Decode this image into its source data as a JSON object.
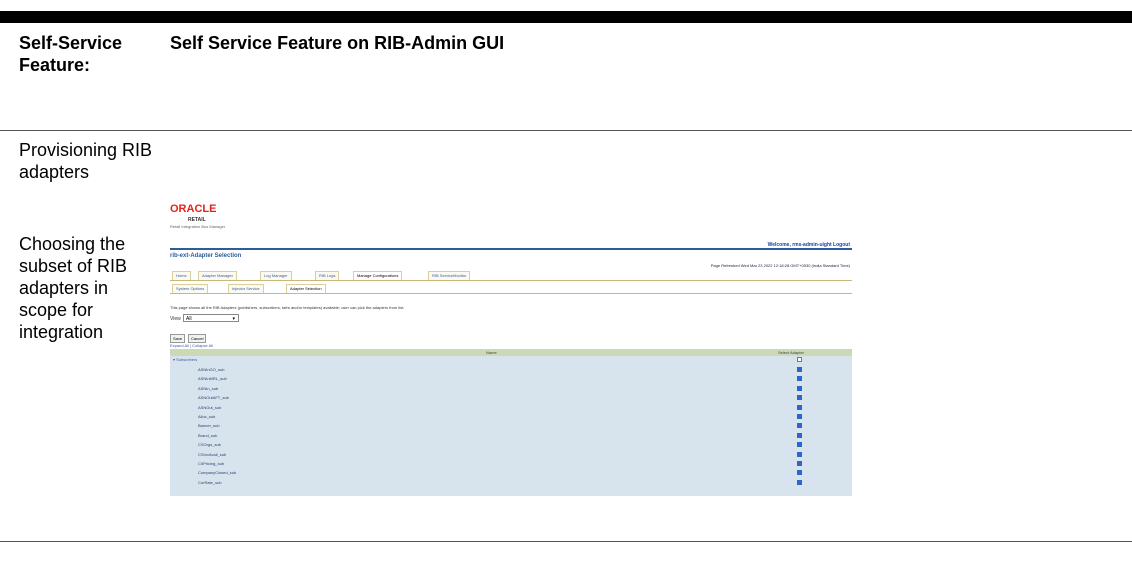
{
  "header": {
    "label": "Self-Service Feature:",
    "title": "Self Service Feature on RIB-Admin GUI"
  },
  "cells": [
    {
      "text": "Provisioning RIB adapters"
    },
    {
      "text": "Choosing the subset of RIB adapters in scope for integration"
    }
  ],
  "screenshot": {
    "logo": "ORACLE",
    "logo_sub": "RETAIL",
    "logo_sub2": "Retail Integration Bus Manager",
    "welcome": "Welcome, rms-admin-uight Logout",
    "page_title": "rib-ext-Adapter Selection",
    "refresh": "Page Refreshed Wed Mar 23 2022 12:18:28 GMT+0530 (India Standard Time)",
    "tabs_primary": [
      "Home",
      "Adapter Manager",
      "Log Manager",
      "RIB Logs",
      "Manage Configurations",
      "RIB ServiceMonitor"
    ],
    "tabs_primary_selected": "Manage Configurations",
    "tabs_secondary": [
      "System Options",
      "Injector Service",
      "Adapter Selection"
    ],
    "tabs_secondary_selected": "Adapter Selection",
    "description": "This page shows all the RIB Adapters (publishers, subscribers, tafrs and/or templates) available; user can pick the adapters from list.",
    "view_label": "View",
    "view_value": "All",
    "buttons": [
      "Save",
      "Cancel"
    ],
    "expand_links": "Expand All | Collapse All",
    "col_name": "Name",
    "col_select": "Select Adapter",
    "group": "Subscribers",
    "rows": [
      "ASNInGO_sub",
      "ASNInMRL_sub",
      "ASNIn_sub",
      "ASNOutAFT_sub",
      "ASNOut_sub",
      "Alloc_sub",
      "Banner_sub",
      "Brand_sub",
      "CSOrgs_sub",
      "CSInvAvail_sub",
      "CIIPricing_sub",
      "CompanyClosed_sub",
      "CurRate_sub"
    ]
  }
}
